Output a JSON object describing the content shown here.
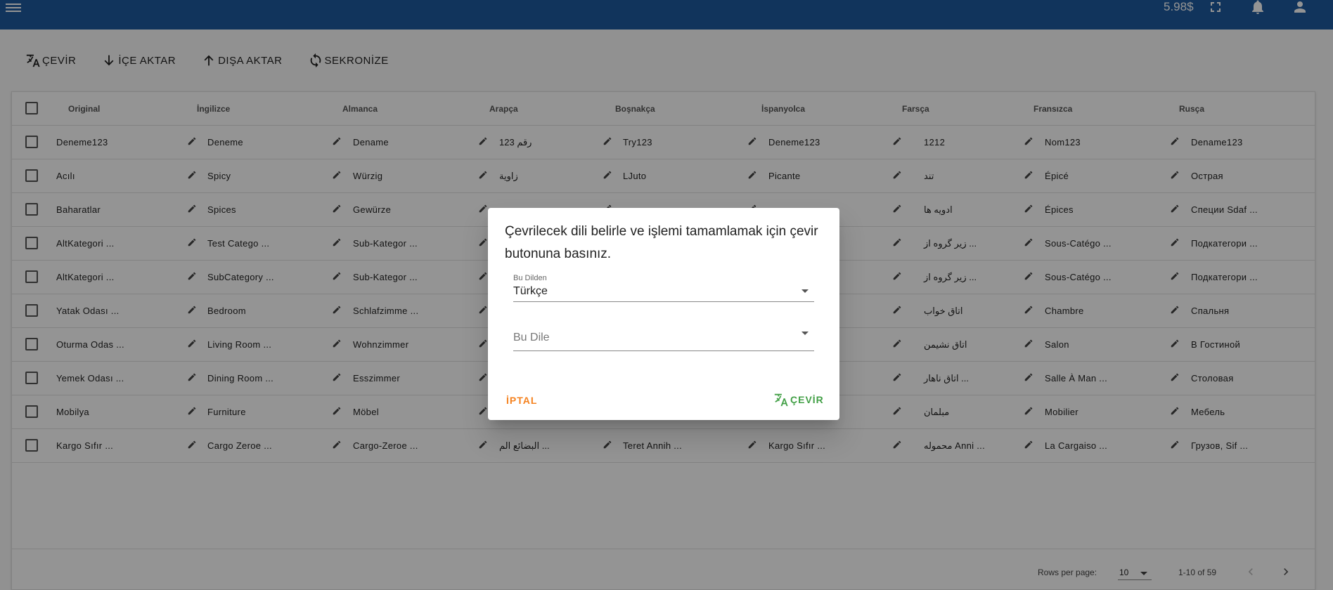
{
  "appbar": {
    "credit": "5.98$",
    "icons": [
      "menu-icon",
      "fullscreen-icon",
      "bell-icon",
      "account-icon"
    ]
  },
  "toolbar": {
    "translate": "ÇEVİR",
    "import": "İÇE AKTAR",
    "export": "DIŞA AKTAR",
    "sync": "SEKRONİZE"
  },
  "table": {
    "headers": [
      "Original",
      "İngilizce",
      "Almanca",
      "Arapça",
      "Boşnakça",
      "İspanyolca",
      "Farsça",
      "Fransızca",
      "Rusça"
    ],
    "rows": [
      [
        "Deneme123",
        "Deneme",
        "Dename",
        "رقم 123",
        "Try123",
        "Deneme123",
        "1212",
        "Nom123",
        "Dename123"
      ],
      [
        "Acılı",
        "Spicy",
        "Würzig",
        "زاوية",
        "LJuto",
        "Picante",
        "تند",
        "Épicé",
        "Острая"
      ],
      [
        "Baharatlar",
        "Spices",
        "Gewürze",
        "",
        "",
        "",
        "ادویه ها",
        "Épices",
        "Специи Sdaf ..."
      ],
      [
        "AltKategori ...",
        "Test Catego ...",
        "Sub-Kategor ...",
        "",
        "",
        "",
        "زیر گروه از ...",
        "Sous-Catégo ...",
        "Подкатегори ..."
      ],
      [
        "AltKategori ...",
        "SubCategory ...",
        "Sub-Kategor ...",
        "",
        "",
        "",
        "زیر گروه از ...",
        "Sous-Catégo ...",
        "Подкатегори ..."
      ],
      [
        "Yatak Odası ...",
        "Bedroom",
        "Schlafzimme ...",
        "",
        "",
        "",
        "اتاق خواب",
        "Chambre",
        "Спальня"
      ],
      [
        "Oturma Odas ...",
        "Living Room ...",
        "Wohnzimmer",
        "",
        "",
        "",
        "اتاق نشیمن",
        "Salon",
        "В Гостиной"
      ],
      [
        "Yemek Odası ...",
        "Dining Room ...",
        "Esszimmer",
        "",
        "",
        "",
        "اتاق ناهار ...",
        "Salle À Man ...",
        "Столовая"
      ],
      [
        "Mobilya",
        "Furniture",
        "Möbel",
        "",
        "",
        "",
        "مبلمان",
        "Mobilier",
        "Мебель"
      ],
      [
        "Kargo Sıfır ...",
        "Cargo Zeroe ...",
        "Cargo-Zeroe ...",
        "البضائع الم ...",
        "Teret Annih ...",
        "Kargo Sıfır ...",
        "محموله Anni ...",
        "La Cargaiso ...",
        "Грузов, Sif ..."
      ]
    ],
    "footer": {
      "rows_per_page_label": "Rows per page:",
      "rows_per_page_value": "10",
      "range": "1-10 of 59"
    }
  },
  "dialog": {
    "title": "Çevrilecek dili belirle ve işlemi tamamlamak için çevir butonuna basınız.",
    "from_label": "Bu Dilden",
    "from_value": "Türkçe",
    "to_placeholder": "Bu Dile",
    "cancel": "İPTAL",
    "confirm": "ÇEVİR",
    "cancel_color": "#f5821f",
    "confirm_color": "#43a047"
  }
}
